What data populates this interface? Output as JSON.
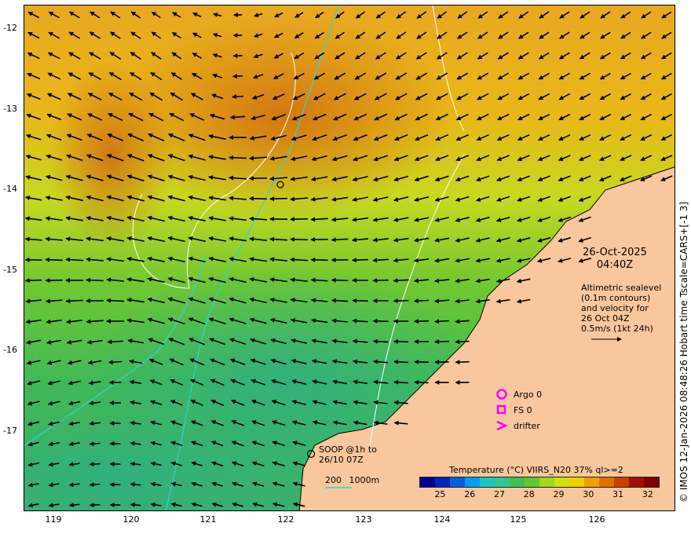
{
  "map": {
    "lon_range": [
      118.6,
      126.95
    ],
    "lat_range": [
      -17.95,
      -11.7
    ],
    "lon_ticks": [
      "119",
      "120",
      "121",
      "122",
      "123",
      "124",
      "125",
      "126"
    ],
    "lat_ticks": [
      "-12",
      "-13",
      "-14",
      "-15",
      "-16",
      "-17"
    ],
    "land_color": "#f9c79d",
    "contour_color": "#ffffff",
    "isobath_color": "#2fd4d4",
    "marker_color": "#ff00ff"
  },
  "date": {
    "line1": "26-Oct-2025",
    "line2": "04:40Z"
  },
  "altimetry": {
    "lines": [
      "Altimetric sealevel",
      "(0.1m contours)",
      "and velocity for",
      "26 Oct 04Z",
      "0.5m/s (1kt 24h)"
    ]
  },
  "legend": {
    "argo": "Argo 0",
    "fs": "FS 0",
    "drifter": "drifter"
  },
  "soop": {
    "line1": "SOOP @1h to",
    "line2": "26/10 07Z"
  },
  "isobath_labels": {
    "a": "200",
    "b": "1000m"
  },
  "colorbar": {
    "title": "Temperature (°C) VIIRS_N20 37% ql>=2",
    "min": 24.3,
    "max": 32.4,
    "ticks": [
      "25",
      "26",
      "27",
      "28",
      "29",
      "30",
      "31",
      "32"
    ],
    "colors": [
      "#00008f",
      "#0022bb",
      "#0060e0",
      "#00a0f0",
      "#18c8c0",
      "#30c890",
      "#40c050",
      "#60c830",
      "#a0d820",
      "#d0e010",
      "#f0d000",
      "#f0a000",
      "#e07000",
      "#c84000",
      "#a01000",
      "#800000"
    ]
  },
  "credit": "© IMOS 12-Jan-2026 08:48:26 Hobart time Tscale=CARS+[-1 3]"
}
